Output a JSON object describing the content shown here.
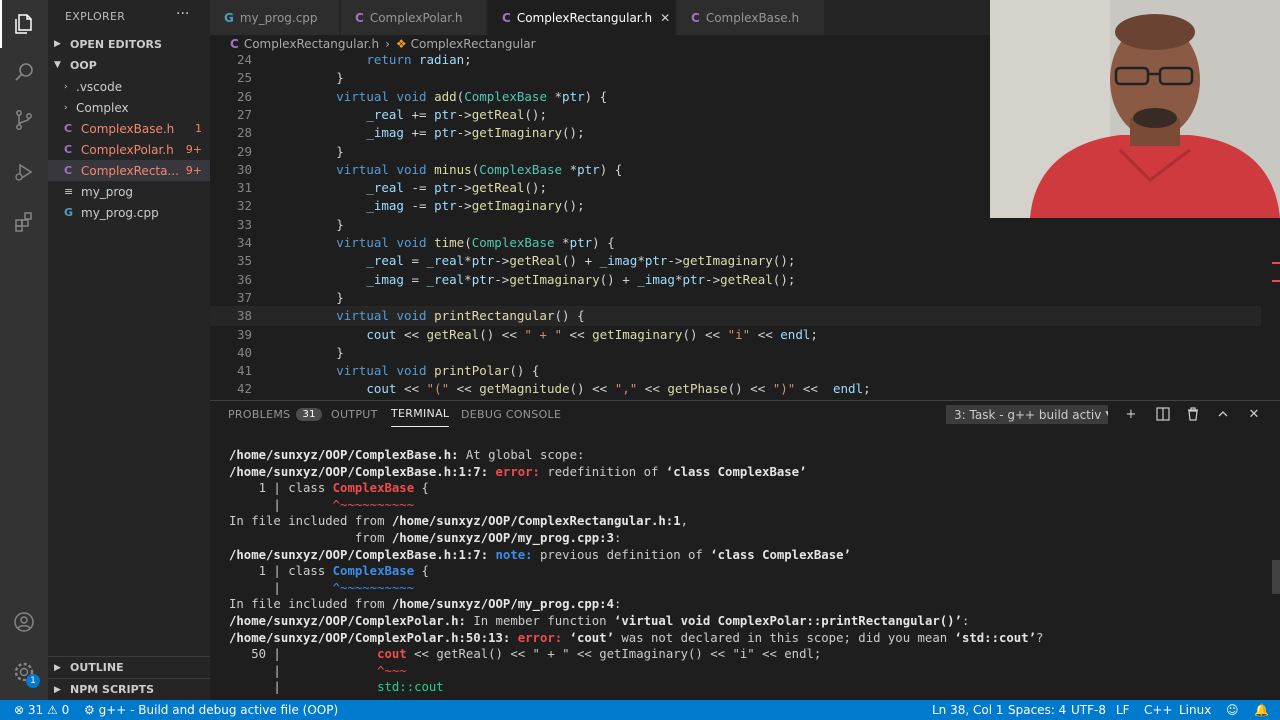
{
  "activity_bar": {
    "icons": [
      "explorer-icon",
      "search-icon",
      "source-control-icon",
      "run-debug-icon",
      "extensions-icon",
      "account-icon",
      "manage-gear-icon"
    ],
    "manage_badge": "1"
  },
  "sidebar": {
    "title": "EXPLORER",
    "more": "···",
    "open_editors": "OPEN EDITORS",
    "folder": "OOP",
    "items": [
      {
        "label": ".vscode",
        "type": "folder"
      },
      {
        "label": "Complex",
        "type": "folder"
      },
      {
        "label": "ComplexBase.h",
        "type": "header",
        "badge": "1"
      },
      {
        "label": "ComplexPolar.h",
        "type": "header",
        "badge": "9+"
      },
      {
        "label": "ComplexRectangular.h",
        "display": "ComplexRecta...",
        "type": "header",
        "badge": "9+"
      },
      {
        "label": "my_prog",
        "type": "file"
      },
      {
        "label": "my_prog.cpp",
        "type": "cpp"
      }
    ],
    "outline": "OUTLINE",
    "npm_scripts": "NPM SCRIPTS"
  },
  "tabs": [
    {
      "label": "my_prog.cpp",
      "icon": "G"
    },
    {
      "label": "ComplexPolar.h",
      "icon": "C"
    },
    {
      "label": "ComplexRectangular.h",
      "icon": "C",
      "active": true
    },
    {
      "label": "ComplexBase.h",
      "icon": "C"
    }
  ],
  "breadcrumb": {
    "file": "ComplexRectangular.h",
    "symbol": "ComplexRectangular"
  },
  "editor": {
    "lines": [
      {
        "n": "24",
        "text": "            return radian;"
      },
      {
        "n": "25",
        "text": "        }"
      },
      {
        "n": "26",
        "text": "        virtual void add(ComplexBase *ptr) {"
      },
      {
        "n": "27",
        "text": "            _real += ptr->getReal();"
      },
      {
        "n": "28",
        "text": "            _imag += ptr->getImaginary();"
      },
      {
        "n": "29",
        "text": "        }"
      },
      {
        "n": "30",
        "text": "        virtual void minus(ComplexBase *ptr) {"
      },
      {
        "n": "31",
        "text": "            _real -= ptr->getReal();"
      },
      {
        "n": "32",
        "text": "            _imag -= ptr->getImaginary();"
      },
      {
        "n": "33",
        "text": "        }"
      },
      {
        "n": "34",
        "text": "        virtual void time(ComplexBase *ptr) {"
      },
      {
        "n": "35",
        "text": "            _real = _real*ptr->getReal() + _imag*ptr->getImaginary();"
      },
      {
        "n": "36",
        "text": "            _imag = _real*ptr->getImaginary() + _imag*ptr->getReal();"
      },
      {
        "n": "37",
        "text": "        }"
      },
      {
        "n": "38",
        "text": "        virtual void printRectangular() {"
      },
      {
        "n": "39",
        "text": "            cout << getReal() << \" + \" << getImaginary() << \"i\" << endl;"
      },
      {
        "n": "40",
        "text": "        }"
      },
      {
        "n": "41",
        "text": "        virtual void printPolar() {"
      },
      {
        "n": "42",
        "text": "            cout << \"(\" << getMagnitude() << \",\" << getPhase() << \")\" <<  endl;"
      }
    ]
  },
  "panel": {
    "tabs": [
      {
        "label": "PROBLEMS",
        "count": "31"
      },
      {
        "label": "OUTPUT"
      },
      {
        "label": "TERMINAL",
        "active": true
      },
      {
        "label": "DEBUG CONSOLE"
      }
    ],
    "task_select": "3: Task - g++ build activ",
    "terminal_lines": [
      "/home/sunxyz/OOP/ComplexBase.h: At global scope:",
      "/home/sunxyz/OOP/ComplexBase.h:1:7: error: redefinition of ‘class ComplexBase’",
      "    1 | class ComplexBase {",
      "      |       ^~~~~~~~~~~",
      "In file included from /home/sunxyz/OOP/ComplexRectangular.h:1,",
      "                 from /home/sunxyz/OOP/my_prog.cpp:3:",
      "/home/sunxyz/OOP/ComplexBase.h:1:7: note: previous definition of ‘class ComplexBase’",
      "    1 | class ComplexBase {",
      "      |       ^~~~~~~~~~~",
      "In file included from /home/sunxyz/OOP/my_prog.cpp:4:",
      "/home/sunxyz/OOP/ComplexPolar.h: In member function ‘virtual void ComplexPolar::printRectangular()’:",
      "/home/sunxyz/OOP/ComplexPolar.h:50:13: error: ‘cout’ was not declared in this scope; did you mean ‘std::cout’?",
      "   50 |             cout << getReal() << \" + \" << getImaginary() << \"i\" << endl;",
      "      |             ^~~~",
      "      |             std::cout"
    ]
  },
  "status": {
    "problems": "31",
    "warnings": "0",
    "task": "g++ - Build and debug active file (OOP)",
    "position": "Ln 38, Col 1",
    "spaces": "Spaces: 4",
    "encoding": "UTF-8",
    "eol": "LF",
    "language": "C++",
    "os": "Linux"
  },
  "colors": {
    "accent": "#007acc",
    "error": "#f14c4c",
    "note": "#3b8eea"
  }
}
